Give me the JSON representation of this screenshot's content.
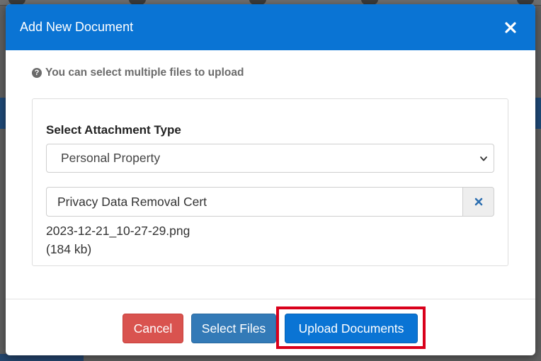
{
  "modal": {
    "title": "Add New Document"
  },
  "hint": {
    "text": "You can select multiple files to upload"
  },
  "attachment": {
    "label": "Select Attachment Type",
    "selected_type": "Personal Property",
    "document_name": "Privacy Data Removal Cert"
  },
  "file": {
    "name": "2023-12-21_10-27-29.png",
    "size": "(184 kb)"
  },
  "footer": {
    "cancel_label": "Cancel",
    "select_files_label": "Select Files",
    "upload_label": "Upload Documents"
  },
  "icons": {
    "close": "close-icon",
    "hint": "question-circle-icon",
    "dropdown": "chevron-down-icon",
    "clear": "times-icon"
  },
  "colors": {
    "header": "#0a74d4",
    "cancel": "#d9534f",
    "select_files": "#337ab7",
    "upload": "#0a74d4",
    "highlight": "#d9001b"
  }
}
